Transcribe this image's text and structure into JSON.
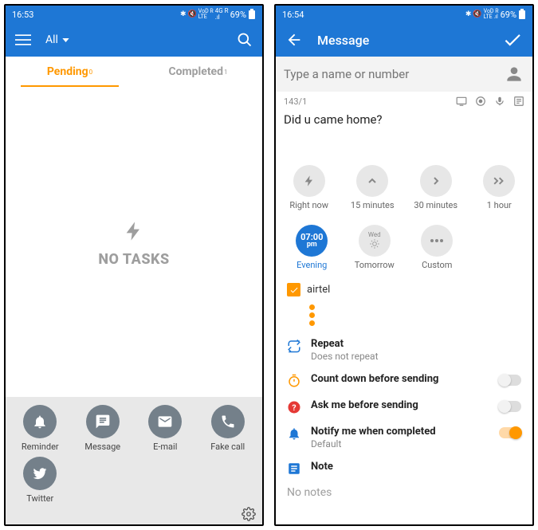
{
  "left": {
    "status_time": "16:53",
    "battery": "69%",
    "filter_label": "All",
    "tabs": {
      "pending_label": "Pending",
      "pending_count": "0",
      "completed_label": "Completed",
      "completed_count": "1"
    },
    "empty_text": "NO TASKS",
    "actions": [
      {
        "icon": "bell-icon",
        "label": "Reminder"
      },
      {
        "icon": "message-icon",
        "label": "Message"
      },
      {
        "icon": "email-icon",
        "label": "E-mail"
      },
      {
        "icon": "phone-icon",
        "label": "Fake call"
      },
      {
        "icon": "twitter-icon",
        "label": "Twitter"
      }
    ]
  },
  "right": {
    "status_time": "16:54",
    "battery": "69%",
    "title": "Message",
    "recipient_placeholder": "Type a name or number",
    "char_counter": "143/1",
    "body_text": "Did u came home?",
    "time_options_row1": [
      {
        "id": "right-now",
        "label": "Right now"
      },
      {
        "id": "15-min",
        "label": "15 minutes"
      },
      {
        "id": "30-min",
        "label": "30 minutes"
      },
      {
        "id": "1-hour",
        "label": "1 hour"
      }
    ],
    "time_options_row2": [
      {
        "id": "evening",
        "label": "Evening",
        "top": "07:00",
        "bottom": "pm",
        "active": true
      },
      {
        "id": "tomorrow",
        "label": "Tomorrow",
        "day": "Wed"
      },
      {
        "id": "custom",
        "label": "Custom"
      }
    ],
    "carrier_label": "airtel",
    "settings": {
      "repeat_label": "Repeat",
      "repeat_value": "Does not repeat",
      "countdown_label": "Count down before sending",
      "ask_label": "Ask me before sending",
      "notify_label": "Notify me when completed",
      "notify_value": "Default",
      "note_label": "Note"
    },
    "notes_placeholder": "No notes"
  }
}
